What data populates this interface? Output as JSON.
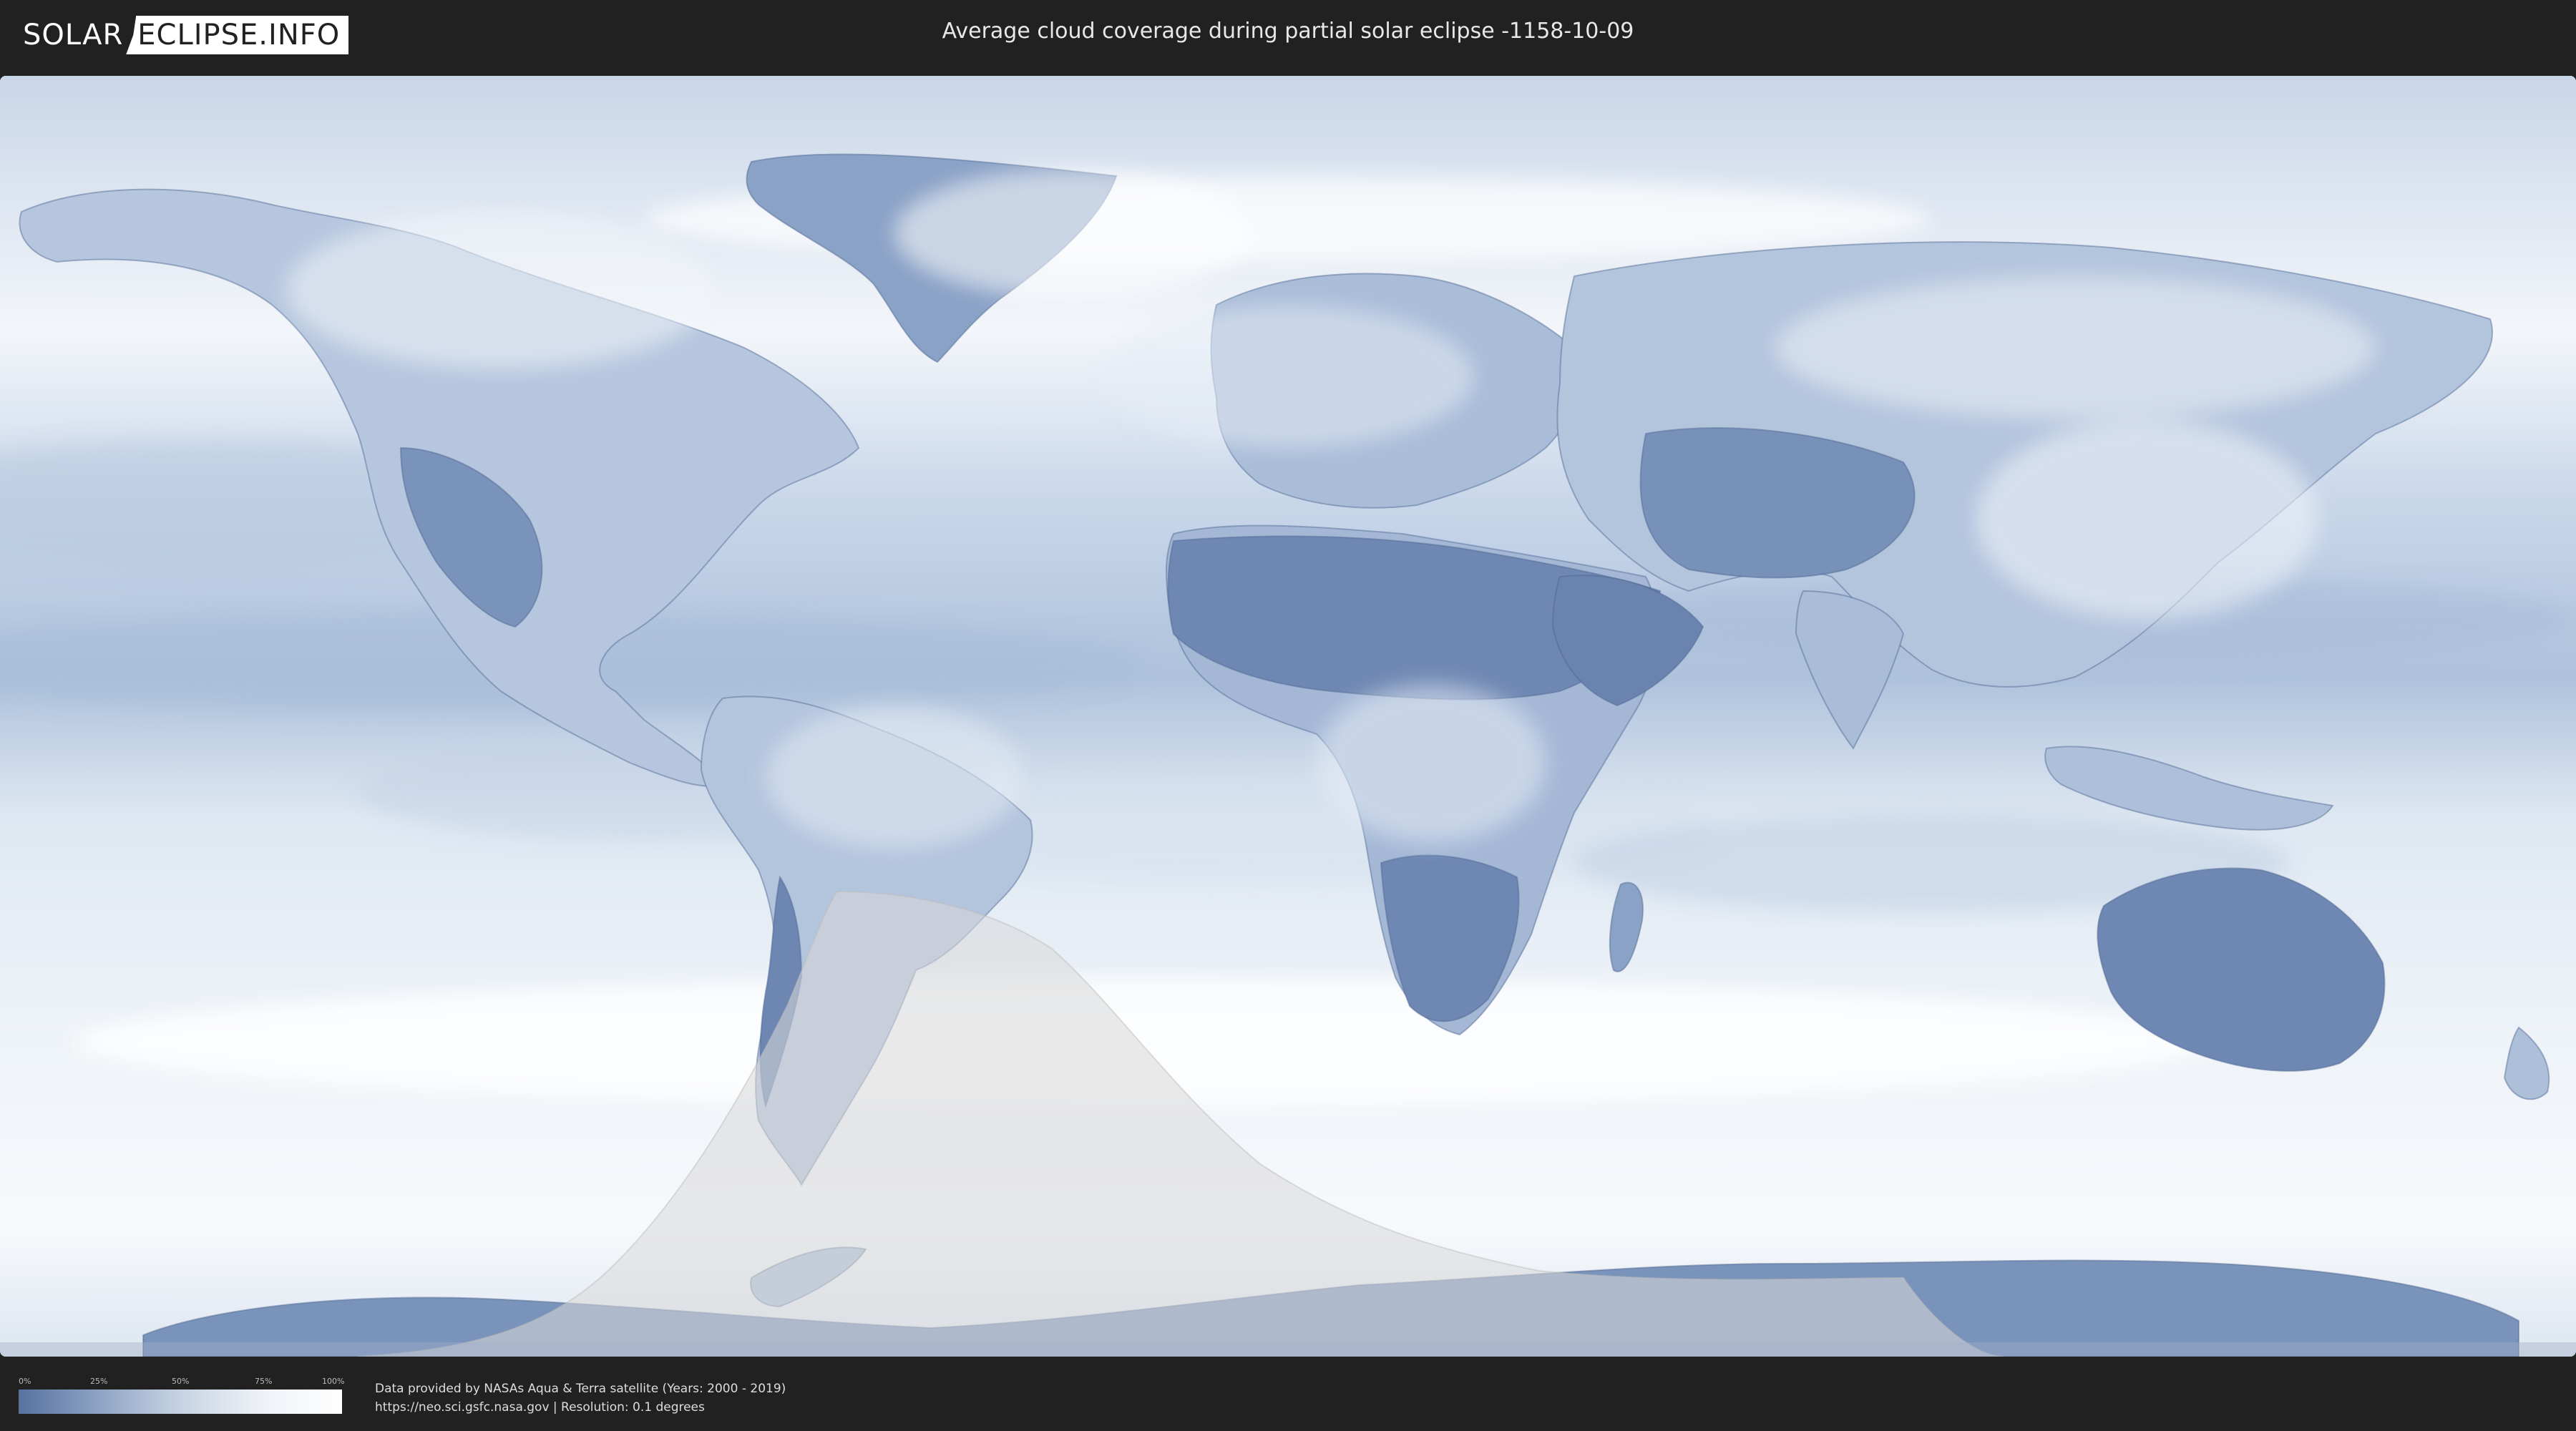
{
  "header": {
    "logo_left": "SOLAR",
    "logo_right": "ECLIPSE.INFO",
    "title": "Average cloud coverage during partial solar eclipse -1158-10-09"
  },
  "legend": {
    "ticks": [
      "0%",
      "25%",
      "50%",
      "75%",
      "100%"
    ],
    "colors": [
      "#5873a1",
      "#8ea4c4",
      "#c7d3e3",
      "#eef2f7",
      "#ffffff"
    ]
  },
  "credits": {
    "line1": "Data provided by NASAs Aqua & Terra satellite (Years: 2000 - 2019)",
    "line2": "https://neo.sci.gsfc.nasa.gov | Resolution: 0.1 degrees"
  },
  "map": {
    "projection": "equirectangular",
    "cloud_low_color": "#6f88b3",
    "cloud_high_color": "#ffffff",
    "eclipse_zone_color": "#d9d9d9"
  }
}
